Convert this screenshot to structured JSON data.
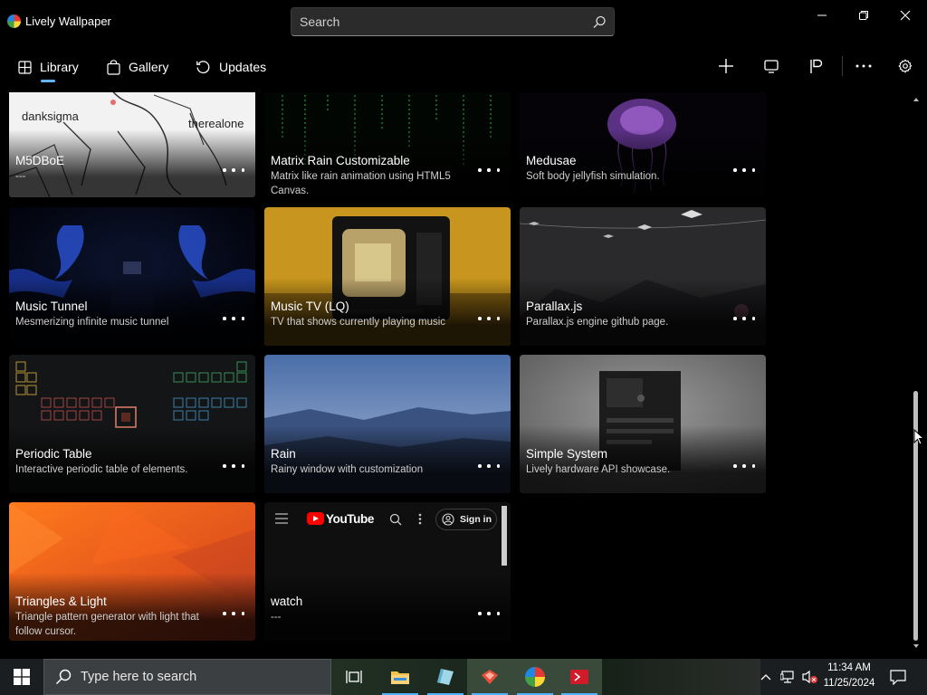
{
  "window": {
    "title": "Lively Wallpaper",
    "search_placeholder": "Search"
  },
  "nav": {
    "tabs": [
      {
        "label": "Library",
        "icon": "grid-icon",
        "selected": true
      },
      {
        "label": "Gallery",
        "icon": "shopping-bag-icon",
        "selected": false
      },
      {
        "label": "Updates",
        "icon": "refresh-icon",
        "selected": false
      }
    ],
    "tools": [
      "add-icon",
      "monitor-icon",
      "customise-icon",
      "more-icon",
      "settings-icon"
    ]
  },
  "wallpapers": [
    {
      "title": "M5DBoE",
      "desc": "---",
      "thumb_text_left": "danksigma",
      "thumb_text_right": "therealone"
    },
    {
      "title": "Matrix Rain Customizable",
      "desc": "Matrix like rain animation using HTML5 Canvas."
    },
    {
      "title": "Medusae",
      "desc": "Soft body jellyfish simulation."
    },
    {
      "title": "Music Tunnel",
      "desc": "Mesmerizing infinite music tunnel"
    },
    {
      "title": "Music TV (LQ)",
      "desc": "TV that shows currently playing music"
    },
    {
      "title": "Parallax.js",
      "desc": "Parallax.js engine github page."
    },
    {
      "title": "Periodic Table",
      "desc": "Interactive periodic table of elements."
    },
    {
      "title": "Rain",
      "desc": "Rainy window with customization"
    },
    {
      "title": "Simple System",
      "desc": "Lively hardware API showcase."
    },
    {
      "title": "Triangles & Light",
      "desc": "Triangle pattern generator with light that follow cursor."
    },
    {
      "title": "watch",
      "desc": "---",
      "thumb_brand": "YouTube",
      "thumb_signin": "Sign in"
    }
  ],
  "taskbar": {
    "search_placeholder": "Type here to search",
    "time": "11:34 AM",
    "date": "11/25/2024",
    "apps": [
      "task-view-icon",
      "file-explorer-icon",
      "sticky-app-icon",
      "red-app-icon",
      "lively-icon",
      "terminal-icon"
    ]
  },
  "colors": {
    "accent": "#62b4ff",
    "background": "#000000",
    "taskbar": "#1b1e20"
  }
}
